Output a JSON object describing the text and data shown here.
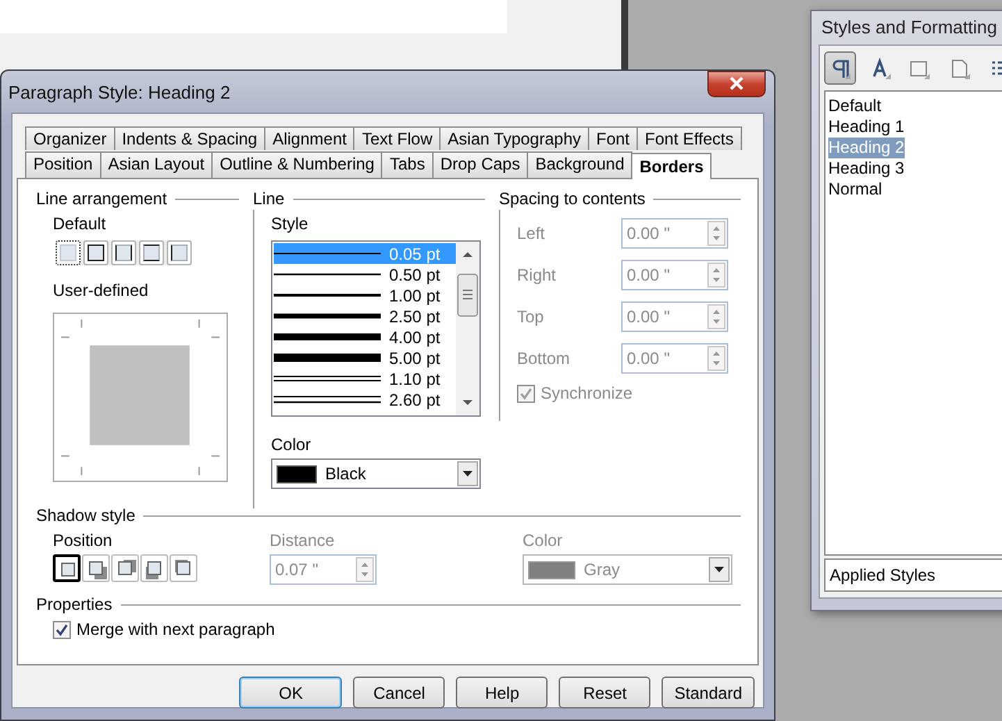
{
  "dialog": {
    "title": "Paragraph Style: Heading 2",
    "tab_rows": [
      [
        {
          "label": "Organizer",
          "selected": false
        },
        {
          "label": "Indents & Spacing",
          "selected": false
        },
        {
          "label": "Alignment",
          "selected": false
        },
        {
          "label": "Text Flow",
          "selected": false
        },
        {
          "label": "Asian Typography",
          "selected": false
        },
        {
          "label": "Font",
          "selected": false
        },
        {
          "label": "Font Effects",
          "selected": false
        }
      ],
      [
        {
          "label": "Position",
          "selected": false
        },
        {
          "label": "Asian Layout",
          "selected": false
        },
        {
          "label": "Outline & Numbering",
          "selected": false
        },
        {
          "label": "Tabs",
          "selected": false
        },
        {
          "label": "Drop Caps",
          "selected": false
        },
        {
          "label": "Background",
          "selected": false
        },
        {
          "label": "Borders",
          "selected": true
        }
      ]
    ],
    "line_arrangement": {
      "title": "Line arrangement",
      "default_label": "Default",
      "presets": [
        {
          "kind": "none",
          "selected": true
        },
        {
          "kind": "all",
          "selected": false
        },
        {
          "kind": "left-right",
          "selected": false
        },
        {
          "kind": "top-bottom",
          "selected": false
        },
        {
          "kind": "left",
          "selected": false
        }
      ],
      "user_defined_label": "User-defined"
    },
    "line": {
      "title": "Line",
      "style_label": "Style",
      "styles": [
        {
          "kind": "hairline",
          "label": "0.05 pt",
          "selected": true
        },
        {
          "kind": "thin",
          "label": "0.50 pt",
          "selected": false
        },
        {
          "kind": "medium",
          "label": "1.00 pt",
          "selected": false
        },
        {
          "kind": "thick",
          "label": "2.50 pt",
          "selected": false
        },
        {
          "kind": "heavy",
          "label": "4.00 pt",
          "selected": false
        },
        {
          "kind": "extra-heavy",
          "label": "5.00 pt",
          "selected": false
        },
        {
          "kind": "double-thin",
          "label": "1.10 pt",
          "selected": false
        },
        {
          "kind": "double",
          "label": "2.60 pt",
          "selected": false
        }
      ],
      "color_label": "Color",
      "color": {
        "value": "Black"
      }
    },
    "spacing": {
      "title": "Spacing to contents",
      "fields": [
        {
          "label": "Left",
          "value": "0.00 \"",
          "disabled": true
        },
        {
          "label": "Right",
          "value": "0.00 \"",
          "disabled": true
        },
        {
          "label": "Top",
          "value": "0.00 \"",
          "disabled": true
        },
        {
          "label": "Bottom",
          "value": "0.00 \"",
          "disabled": true
        }
      ],
      "synchronize": {
        "label": "Synchronize",
        "checked": true,
        "disabled": true
      }
    },
    "shadow": {
      "title": "Shadow style",
      "position_label": "Position",
      "positions": [
        {
          "kind": "none",
          "selected": true
        },
        {
          "kind": "bottom-right",
          "selected": false
        },
        {
          "kind": "top-right",
          "selected": false
        },
        {
          "kind": "bottom-left",
          "selected": false
        },
        {
          "kind": "top-left",
          "selected": false
        }
      ],
      "distance": {
        "label": "Distance",
        "value": "0.07 \"",
        "disabled": true
      },
      "color": {
        "label": "Color",
        "value": "Gray",
        "disabled": true
      }
    },
    "properties": {
      "title": "Properties",
      "merge": {
        "label": "Merge with next paragraph",
        "checked": true
      }
    },
    "buttons": [
      {
        "label": "OK",
        "default": true
      },
      {
        "label": "Cancel",
        "default": false
      },
      {
        "label": "Help",
        "default": false
      },
      {
        "label": "Reset",
        "default": false
      },
      {
        "label": "Standard",
        "default": false
      }
    ]
  },
  "styles_panel": {
    "title": "Styles and Formatting",
    "toolbar": [
      {
        "kind": "paragraph",
        "selected": true
      },
      {
        "kind": "character",
        "selected": false
      },
      {
        "kind": "frame",
        "selected": false
      },
      {
        "kind": "page",
        "selected": false
      },
      {
        "kind": "list",
        "selected": false
      }
    ],
    "items": [
      {
        "label": "Default",
        "selected": false
      },
      {
        "label": "Heading 1",
        "selected": false
      },
      {
        "label": "Heading 2",
        "selected": true
      },
      {
        "label": "Heading 3",
        "selected": false
      },
      {
        "label": "Normal",
        "selected": false
      }
    ],
    "filter": "Applied Styles"
  }
}
